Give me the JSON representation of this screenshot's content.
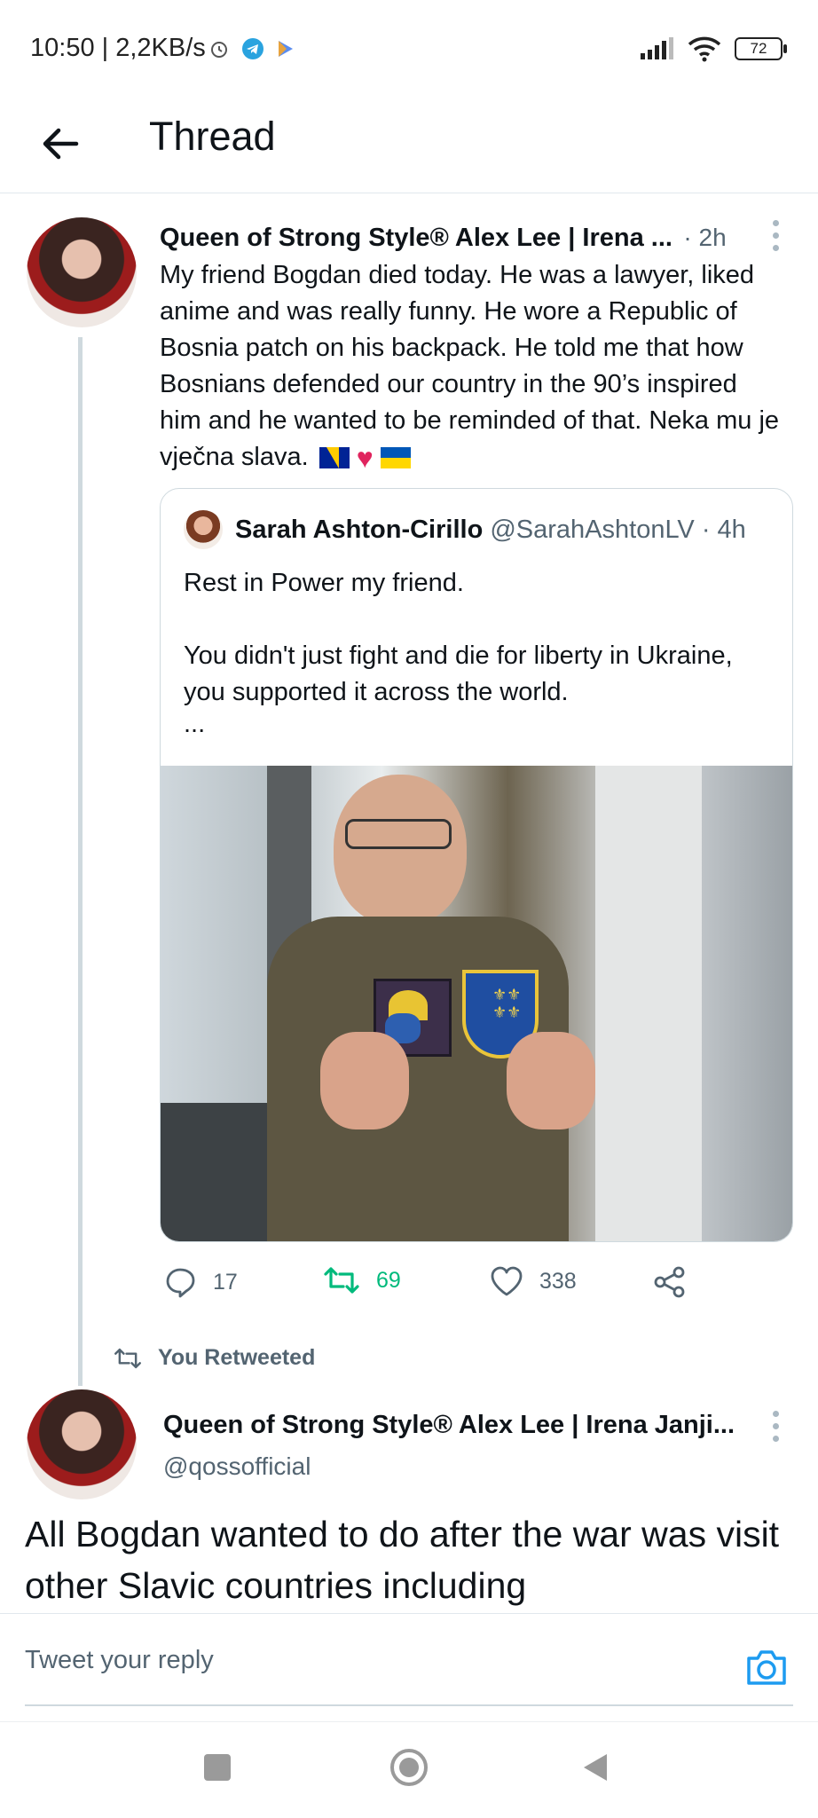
{
  "status_bar": {
    "time": "10:50 | 2,2KB/s",
    "battery": "72"
  },
  "header": {
    "title": "Thread"
  },
  "tweet_main": {
    "author": "Queen of Strong Style® Alex Lee | Irena ...",
    "time": "· 2h",
    "text": "My friend Bogdan died today. He was a lawyer, liked anime and was really funny. He wore a Republic of Bosnia patch on his backpack. He told me that how Bosnians defended our country in the 90’s inspired him and he wanted to be reminded of that. Neka mu je vječna slava."
  },
  "quote": {
    "author": "Sarah Ashton-Cirillo",
    "handle": "@SarahAshtonLV",
    "time": "· 4h",
    "line1": "Rest in Power my friend.",
    "line2": "You didn't just fight and die for liberty in Ukraine, you supported it across the world.",
    "ellipsis": "..."
  },
  "actions": {
    "replies": "17",
    "retweets": "69",
    "likes": "338"
  },
  "retweet_banner": {
    "label": "You Retweeted"
  },
  "tweet_second": {
    "author": "Queen of Strong Style® Alex Lee | Irena Janji...",
    "handle": "@qossofficial",
    "text": "All Bogdan wanted to do after the war was visit other Slavic countries including"
  },
  "reply": {
    "placeholder": "Tweet your reply"
  },
  "colors": {
    "retweet_green": "#00ba7c",
    "muted_gray": "#536471",
    "camera_blue": "#1d9bf0"
  }
}
